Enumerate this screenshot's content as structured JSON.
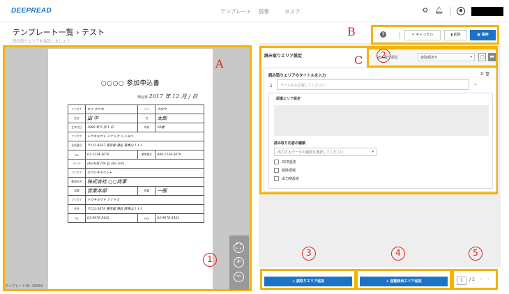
{
  "header": {
    "logo": "DEEPREAD",
    "nav": [
      "テンプレート",
      "辞書",
      "タスク"
    ]
  },
  "page": {
    "title": "テンプレート一覧 › テスト",
    "subtitle": "読み取りエリアを指定しましょう"
  },
  "toolbar": {
    "cancel_label": "キャンセル",
    "delete_label": "削除",
    "save_label": "保存"
  },
  "document": {
    "title": "○○○○ 参加申込書",
    "date_label": "申込日",
    "date_value": "2017 年 12 月 / 日",
    "rows": [
      {
        "l1": "フリガナ",
        "v1": "セイ タナカ",
        "l2": "メイ",
        "v2": "タロウ"
      },
      {
        "l1": "氏名",
        "v1": "田 中",
        "l2": "名",
        "v2": "太郎"
      },
      {
        "l1": "生年月日",
        "v1": "1989 年 5 月 1 日",
        "l2": "年齢",
        "v2": "28歳"
      },
      {
        "l1": "フリガナ",
        "v1": "トウキョウト ミナトク シンヨコ",
        "l2": "",
        "v2": ""
      },
      {
        "l1": "住所番号",
        "v1": "〒123-4567 東京都 港区 東青山 1-1-1",
        "l2": "",
        "v2": ""
      },
      {
        "l1": "TEL",
        "v1": "03-1234-5678",
        "l2": "携帯番号",
        "v2": "080-1234-5678"
      },
      {
        "l1": "メール",
        "v1": "abcdef1234 @ abc.com",
        "l2": "",
        "v2": ""
      },
      {
        "l1": "フリガナ",
        "v1": "カブシキガイシャ",
        "l2": "",
        "v2": ""
      },
      {
        "l1": "勤務先名",
        "v1": "株式会社 ○○商事",
        "l2": "",
        "v2": ""
      },
      {
        "l1": "部署",
        "v1": "営業本部",
        "l2": "役職",
        "v2": "一般"
      },
      {
        "l1": "フリガナ",
        "v1": "トウキョウト ミナトク",
        "l2": "",
        "v2": ""
      },
      {
        "l1": "住所",
        "v1": "〒123-5678 東京都 港区 西青山 1-1-1",
        "l2": "",
        "v2": ""
      },
      {
        "l1": "TEL",
        "v1": "03-9876-5432",
        "l2": "FAX",
        "v2": "03-9876-5432"
      }
    ],
    "template_id": "テンプレートID: 15069"
  },
  "panel": {
    "heading": "読み取りエリア設定",
    "control_label": "読み取り順位",
    "control_select": "読取順あり",
    "field_title_label": "読み取りエリアのタイトルを入力",
    "field_number": "1",
    "field_placeholder": "ラベル名を記載してください",
    "recog_area_label": "認識エリア設定",
    "content_type_label": "読み取り内容の種類",
    "content_type_placeholder": "出力するデータの種類を選択してください",
    "checkboxes": [
      "OCR設定",
      "削除領域",
      "出力時設定"
    ]
  },
  "bottom": {
    "add_area_label": "+ 読取りエリア追加",
    "auto_area_label": "+ 自動検出エリア追加",
    "page_current": "1",
    "page_total": "/ 1"
  },
  "annotations": {
    "A": "A",
    "B": "B",
    "C": "C",
    "n1": "1",
    "n2": "2",
    "n3": "3",
    "n4": "4",
    "n5": "5"
  },
  "colors": {
    "highlight": "#f4b400",
    "primary": "#1a73c7",
    "marker": "#e02020"
  }
}
